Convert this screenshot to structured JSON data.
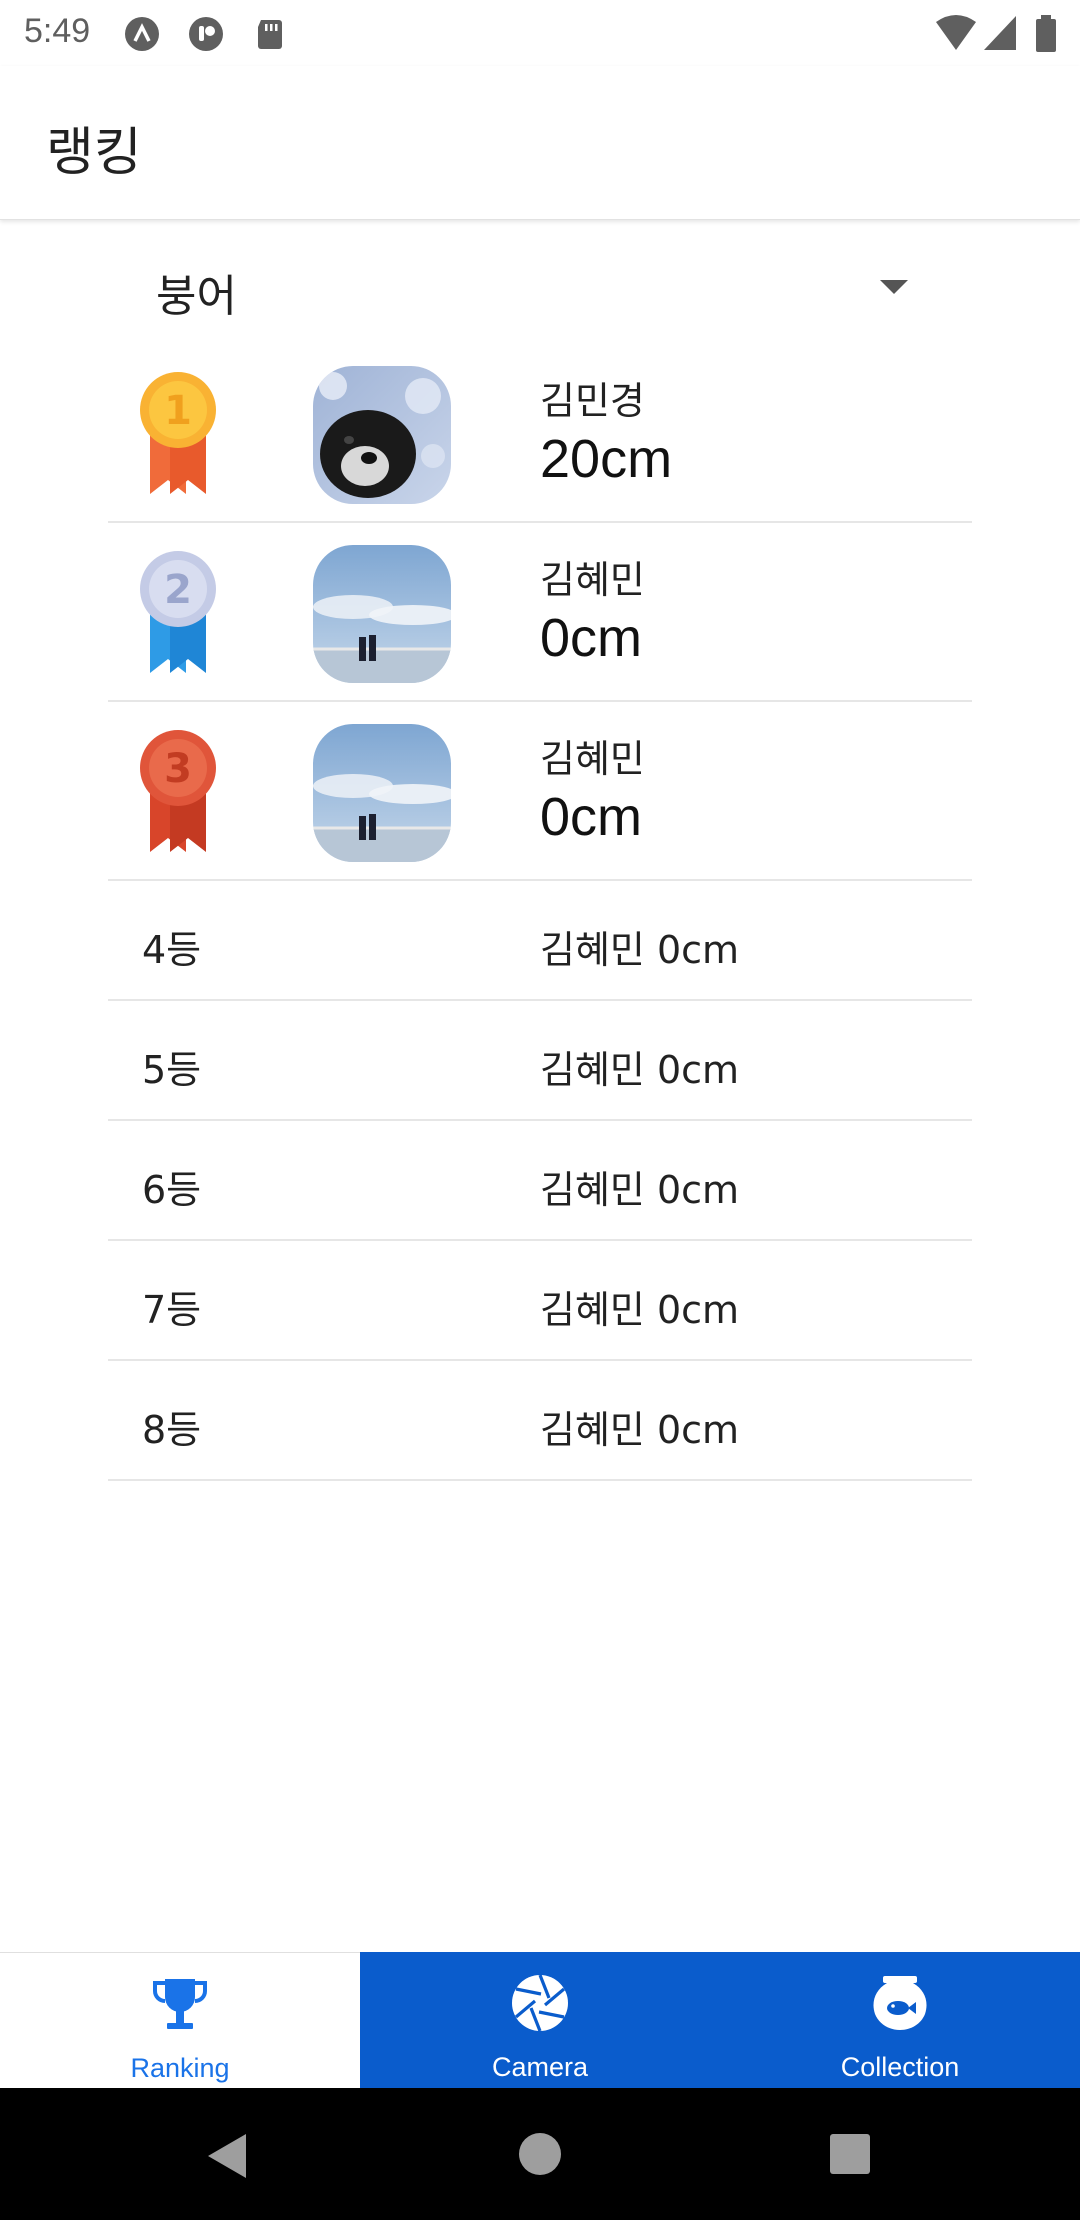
{
  "status_bar": {
    "time": "5:49"
  },
  "app_bar": {
    "title": "랭킹"
  },
  "filter": {
    "selected": "붕어"
  },
  "top_ranks": [
    {
      "name": "김민경",
      "value": "20cm",
      "medal": "gold-medal",
      "photo": "dog-photo"
    },
    {
      "name": "김혜민",
      "value": "0cm",
      "medal": "silver-medal",
      "photo": "sky-photo"
    },
    {
      "name": "김혜민",
      "value": "0cm",
      "medal": "bronze-medal",
      "photo": "sky-photo"
    }
  ],
  "other_ranks": [
    {
      "rank": "4등",
      "text": "김혜민 0cm"
    },
    {
      "rank": "5등",
      "text": "김혜민 0cm"
    },
    {
      "rank": "6등",
      "text": "김혜민 0cm"
    },
    {
      "rank": "7등",
      "text": "김혜민 0cm"
    },
    {
      "rank": "8등",
      "text": "김혜민 0cm"
    }
  ],
  "bottom_nav": {
    "ranking": "Ranking",
    "camera": "Camera",
    "collection": "Collection",
    "active_color": "#1a73e8",
    "bar_color": "#0a5ccc"
  }
}
